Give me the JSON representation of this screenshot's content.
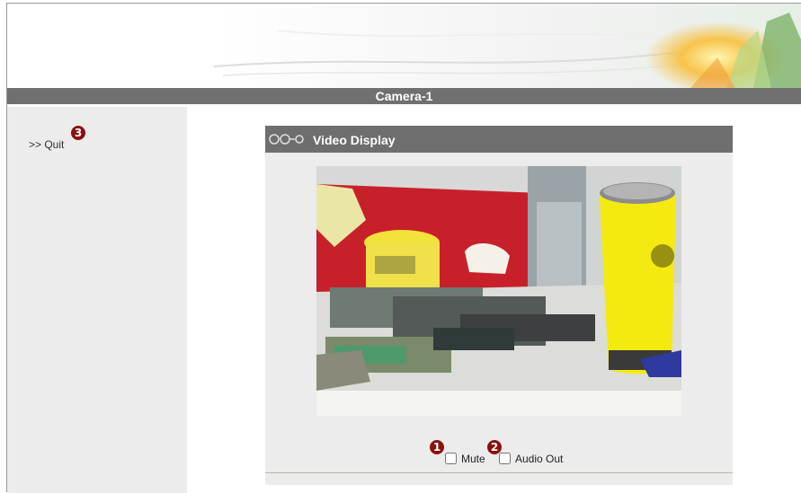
{
  "header": {
    "title": "Camera-1"
  },
  "sidebar": {
    "quit_label": ">> Quit"
  },
  "panel": {
    "title": "Video Display"
  },
  "controls": {
    "mute_label": "Mute",
    "audio_out_label": "Audio Out",
    "mute_checked": false,
    "audio_out_checked": false
  },
  "annotations": {
    "badge_1": "1",
    "badge_2": "2",
    "badge_3": "3"
  },
  "colors": {
    "header_bar": "#707070",
    "sidebar_bg": "#ececec",
    "badge": "#8b1010",
    "checkbox_border": "#1f4f8a"
  },
  "icons": {
    "panel_icon": "chain-rings-icon"
  }
}
